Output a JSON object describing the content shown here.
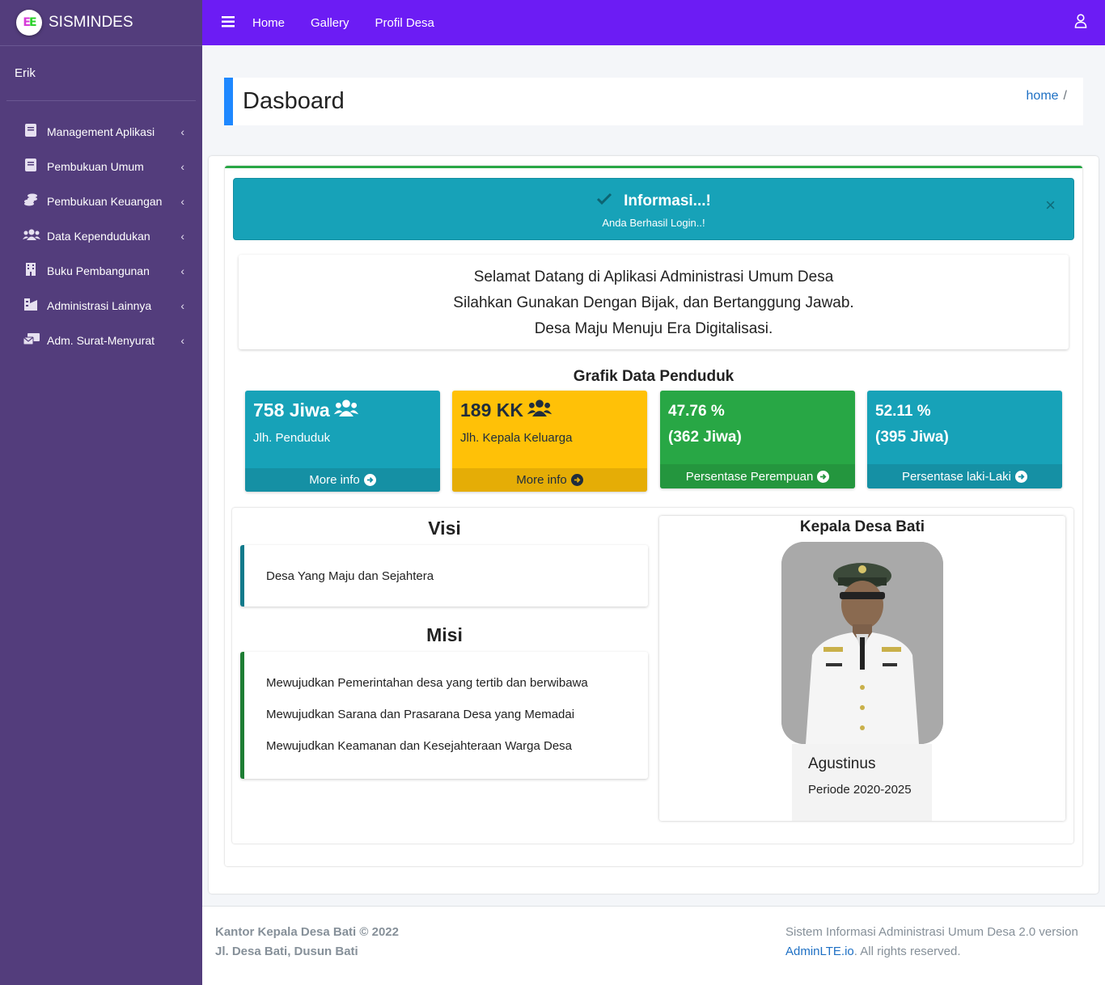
{
  "brand": {
    "name": "SISMINDES",
    "logo_letters": "EE"
  },
  "user": {
    "name": "Erik"
  },
  "sidebar": {
    "items": [
      {
        "label": "Management Aplikasi",
        "icon": "book-icon"
      },
      {
        "label": "Pembukuan Umum",
        "icon": "book-icon"
      },
      {
        "label": "Pembukuan Keuangan",
        "icon": "coins-icon"
      },
      {
        "label": "Data Kependudukan",
        "icon": "users-icon"
      },
      {
        "label": "Buku Pembangunan",
        "icon": "building-icon"
      },
      {
        "label": "Administrasi Lainnya",
        "icon": "city-icon"
      },
      {
        "label": "Adm. Surat-Menyurat",
        "icon": "mail-bulk-icon"
      }
    ]
  },
  "topnav": {
    "links": [
      "Home",
      "Gallery",
      "Profil Desa"
    ]
  },
  "header": {
    "title": "Dasboard",
    "breadcrumb_home": "home",
    "breadcrumb_sep": "/"
  },
  "alert": {
    "title": "Informasi...!",
    "text": "Anda Berhasil Login..!",
    "close": "×"
  },
  "welcome": {
    "line1": "Selamat Datang di Aplikasi Administrasi Umum Desa",
    "line2": "Silahkan Gunakan Dengan Bijak, dan Bertanggung Jawab.",
    "line3": "Desa Maju Menuju Era Digitalisasi."
  },
  "stats": {
    "title": "Grafik Data Penduduk",
    "boxes": [
      {
        "value": "758 Jiwa",
        "label": "Jlh. Penduduk",
        "footer": "More info"
      },
      {
        "value": "189 KK",
        "label": "Jlh. Kepala Keluarga",
        "footer": "More info"
      },
      {
        "value": "47.76 %",
        "value2": "(362 Jiwa)",
        "footer": "Persentase Perempuan"
      },
      {
        "value": "52.11 %",
        "value2": "(395 Jiwa)",
        "footer": "Persentase laki-Laki"
      }
    ]
  },
  "visi": {
    "title": "Visi",
    "text": "Desa Yang Maju dan Sejahtera"
  },
  "misi": {
    "title": "Misi",
    "items": [
      "Mewujudkan Pemerintahan desa yang tertib dan berwibawa",
      "Mewujudkan Sarana dan Prasarana Desa yang Memadai",
      "Mewujudkan Keamanan dan Kesejahteraan Warga Desa"
    ]
  },
  "kepala": {
    "title": "Kepala Desa Bati",
    "name": "Agustinus",
    "period": "Periode 2020-2025"
  },
  "footer": {
    "left1": "Kantor Kepala Desa Bati © 2022",
    "left2": "Jl. Desa Bati, Dusun Bati",
    "right1": "Sistem Informasi Administrasi Umum Desa 2.0 version",
    "right_link": "AdminLTE.io",
    "right2": ". All rights reserved."
  },
  "colors": {
    "sidebar": "#533d7c",
    "topbar": "#6c1cf4",
    "info": "#17a2b8",
    "warning": "#ffc107",
    "success": "#28a745",
    "accent": "#1e88ff"
  }
}
